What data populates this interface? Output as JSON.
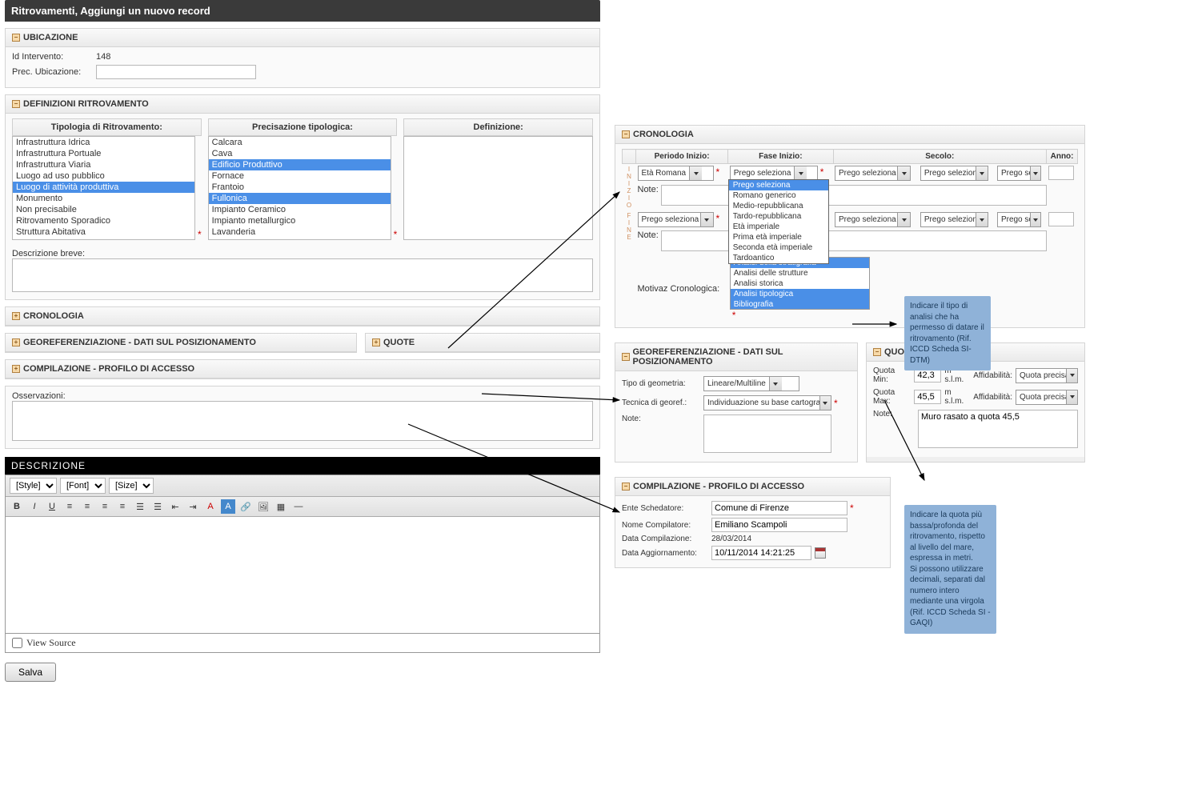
{
  "header": {
    "title": "Ritrovamenti, Aggiungi un nuovo record"
  },
  "ubicazione": {
    "title": "UBICAZIONE",
    "id_label": "Id Intervento:",
    "id_value": "148",
    "prec_label": "Prec. Ubicazione:"
  },
  "definizioni": {
    "title": "DEFINIZIONI RITROVAMENTO",
    "col1": "Tipologia di Ritrovamento:",
    "col2": "Precisazione tipologica:",
    "col3": "Definizione:",
    "tipologia": [
      "Infrastruttura Idrica",
      "Infrastruttura Portuale",
      "Infrastruttura Viaria",
      "Luogo ad uso pubblico",
      "Luogo di attività produttiva",
      "Monumento",
      "Non precisabile",
      "Ritrovamento Sporadico",
      "Struttura Abitativa"
    ],
    "tipologia_sel": 4,
    "precisazione": [
      "Calcara",
      "Cava",
      "Edificio Produttivo",
      "Fornace",
      "Frantoio",
      "Fullonica",
      "Impianto Ceramico",
      "Impianto metallurgico",
      "Lavanderia"
    ],
    "precisazione_sel": [
      2,
      5
    ],
    "desc_breve_label": "Descrizione breve:"
  },
  "sections": {
    "cronologia": "CRONOLOGIA",
    "georef": "GEOREFERENZIAZIONE - DATI SUL POSIZIONAMENTO",
    "quote": "QUOTE",
    "compilazione": "COMPILAZIONE - PROFILO DI ACCESSO"
  },
  "osservazioni_label": "Osservazioni:",
  "desc_panel": "DESCRIZIONE",
  "editor": {
    "style": "[Style]",
    "font": "[Font]",
    "size": "[Size]",
    "view_source": "View Source"
  },
  "save": "Salva",
  "right_crono": {
    "headers": {
      "periodo_inizio": "Periodo Inizio:",
      "fase_inizio": "Fase Inizio:",
      "secolo": "Secolo:",
      "anno": "Anno:"
    },
    "inizio_label": "INIZIO",
    "fine_label": "FINE",
    "periodo_inizio": "Età Romana",
    "fase_inizio": "Prego seleziona",
    "fase_options": [
      "Prego seleziona",
      "Romano generico",
      "Medio-repubblicana",
      "Tardo-repubblicana",
      "Età imperiale",
      "Prima età imperiale",
      "Seconda età imperiale",
      "Tardoantico"
    ],
    "secolo1": "Prego seleziona",
    "secolo2": "Prego selezion",
    "secolo3": "Prego se",
    "note_label": "Note:",
    "fine_periodo": "Prego seleziona",
    "motivaz_label": "Motivaz Cronologica:",
    "motivaz": [
      "Analisi della stratigrafia",
      "Analisi delle strutture",
      "Analisi storica",
      "Analisi tipologica",
      "Bibliografia"
    ],
    "motivaz_sel": [
      0,
      3,
      4
    ]
  },
  "callout1": "Indicare il tipo di analisi che ha permesso di datare il ritrovamento (Rif. ICCD Scheda SI-DTM)",
  "right_georef": {
    "tipo_label": "Tipo di geometria:",
    "tipo_value": "Lineare/Multiline",
    "tecnica_label": "Tecnica di georef.:",
    "tecnica_value": "Individuazione su base cartografic",
    "note_label": "Note:"
  },
  "right_quote": {
    "min_label": "Quota Min:",
    "min_value": "42,3",
    "msl": "m s.l.m.",
    "aff_label": "Affidabilità:",
    "aff_value": "Quota precisa",
    "max_label": "Quota Max:",
    "max_value": "45,5",
    "note_label": "Note:",
    "note_value": "Muro rasato a quota 45,5"
  },
  "right_comp": {
    "ente_label": "Ente Schedatore:",
    "ente_value": "Comune di Firenze",
    "nome_label": "Nome Compilatore:",
    "nome_value": "Emiliano Scampoli",
    "datac_label": "Data Compilazione:",
    "datac_value": "28/03/2014",
    "dataa_label": "Data Aggiornamento:",
    "dataa_value": "10/11/2014 14:21:25"
  },
  "callout2": "Indicare la quota più bassa/profonda del ritrovamento, rispetto al livello del mare, espressa in metri.\nSi possono utilizzare decimali, separati dal numero intero mediante una virgola\n(Rif. ICCD Scheda SI - GAQI)"
}
